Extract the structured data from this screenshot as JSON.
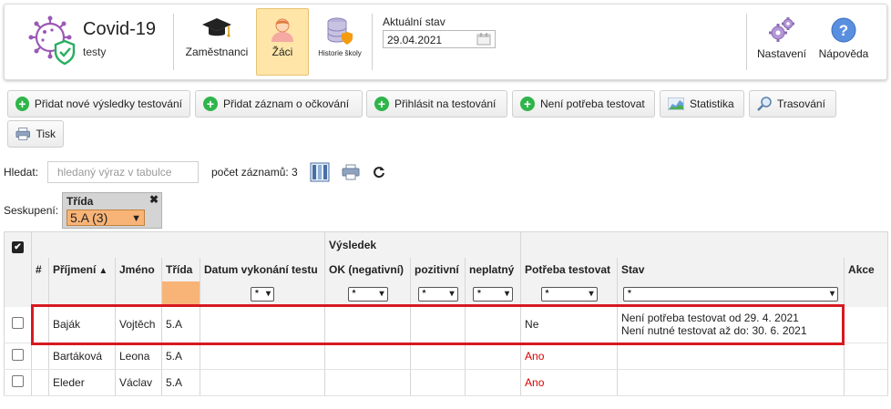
{
  "header": {
    "app_title": "Covid-19",
    "app_subtitle": "testy",
    "nav": [
      {
        "label": "Zaměstnanci",
        "icon": "graduation-cap-icon"
      },
      {
        "label": "Žáci",
        "icon": "student-avatar-icon",
        "active": true
      },
      {
        "label": "Historie školy",
        "icon": "database-shield-icon"
      }
    ],
    "state_label": "Aktuální stav",
    "state_date": "29.04.2021",
    "settings_label": "Nastavení",
    "help_label": "Nápověda"
  },
  "toolbar": {
    "add_results": "Přidat nové výsledky testování",
    "add_vaccination": "Přidat záznam o očkování",
    "register_testing": "Přihlásit na testování",
    "no_testing_needed": "Není potřeba testovat",
    "statistics": "Statistika",
    "tracing": "Trasování",
    "print": "Tisk"
  },
  "search": {
    "label": "Hledat:",
    "placeholder": "hledaný výraz v tabulce",
    "count_text": "počet záznamů: 3"
  },
  "grouping": {
    "label": "Seskupení:",
    "title": "Třída",
    "close": "✖",
    "value": "5.A (3)"
  },
  "table": {
    "group_header": "Výsledek",
    "columns": [
      "#",
      "Příjmení",
      "Jméno",
      "Třída",
      "Datum vykonání testu",
      "OK (negativní)",
      "pozitivní",
      "neplatný",
      "Potřeba testovat",
      "Stav",
      "Akce"
    ],
    "filter_value": "*",
    "rows": [
      {
        "surname": "Baják",
        "name": "Vojtěch",
        "class": "5.A",
        "need": "Ne",
        "need_color": "#222222",
        "status_line1": "Není potřeba testovat od 29. 4. 2021",
        "status_line2": "Není nutné testovat až do: 30. 6. 2021"
      },
      {
        "surname": "Bartáková",
        "name": "Leona",
        "class": "5.A",
        "need": "Ano",
        "need_color": "#d40000",
        "status_line1": "",
        "status_line2": ""
      },
      {
        "surname": "Eleder",
        "name": "Václav",
        "class": "5.A",
        "need": "Ano",
        "need_color": "#d40000",
        "status_line1": "",
        "status_line2": ""
      }
    ]
  },
  "colors": {
    "active_nav": "#ffe6a8",
    "group_value": "#f8b477",
    "highlight": "#d71921",
    "add_icon": "#2fb54a"
  }
}
